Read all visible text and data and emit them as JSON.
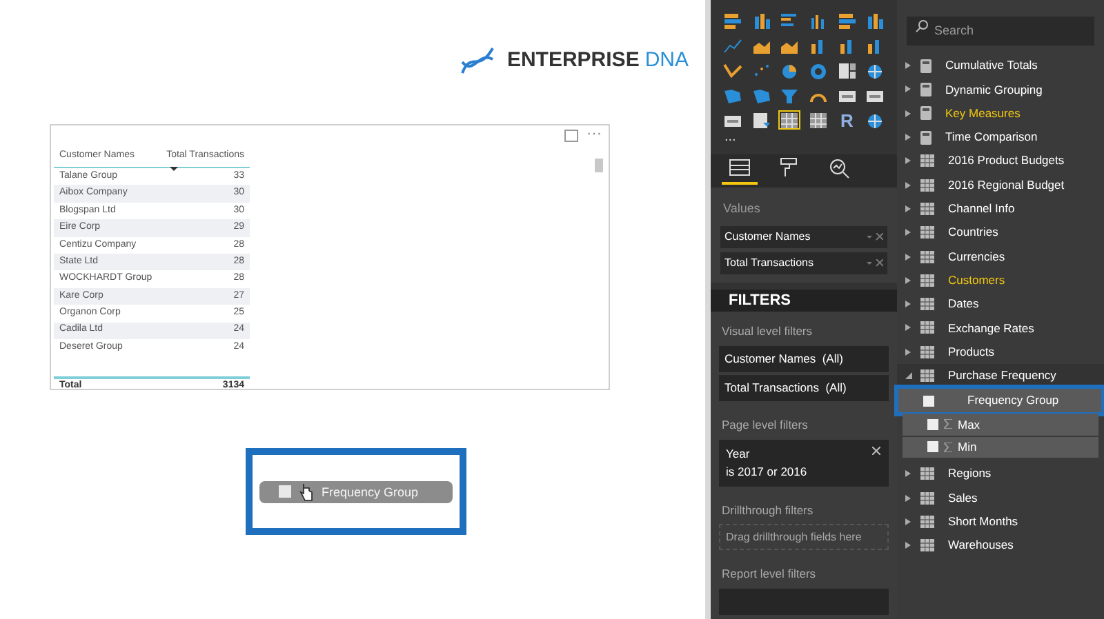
{
  "logo": {
    "text_bold": "ENTERPRISE",
    "text_light": "DNA"
  },
  "table_visual": {
    "menu": "···",
    "columns": [
      {
        "label": "Customer Names",
        "sorted": false
      },
      {
        "label": "Total Transactions",
        "sorted": true
      }
    ],
    "rows": [
      [
        "Talane Group",
        "33"
      ],
      [
        "Aibox Company",
        "30"
      ],
      [
        "Blogspan Ltd",
        "30"
      ],
      [
        "Eire Corp",
        "29"
      ],
      [
        "Centizu Company",
        "28"
      ],
      [
        "State Ltd",
        "28"
      ],
      [
        "WOCKHARDT Group",
        "28"
      ],
      [
        "Kare Corp",
        "27"
      ],
      [
        "Organon Corp",
        "25"
      ],
      [
        "Cadila Ltd",
        "24"
      ],
      [
        "Deseret Group",
        "24"
      ]
    ],
    "total": [
      "Total",
      "3134"
    ]
  },
  "drag_item": {
    "label": "Frequency Group",
    "checked": false,
    "outlined": true
  },
  "visualizations": {
    "gallery": [
      {
        "kind": "stacked-bar",
        "selected": false
      },
      {
        "kind": "stacked-column",
        "selected": false
      },
      {
        "kind": "clustered-bar",
        "selected": false
      },
      {
        "kind": "clustered-column",
        "selected": false
      },
      {
        "kind": "stacked-bar",
        "selected": false
      },
      {
        "kind": "stacked-column",
        "selected": false
      },
      {
        "kind": "line",
        "selected": false
      },
      {
        "kind": "area",
        "selected": false
      },
      {
        "kind": "area",
        "selected": false
      },
      {
        "kind": "column",
        "selected": false
      },
      {
        "kind": "column",
        "selected": false
      },
      {
        "kind": "column",
        "selected": false
      },
      {
        "kind": "ribbon",
        "selected": false
      },
      {
        "kind": "scatter",
        "selected": false
      },
      {
        "kind": "pie",
        "selected": false
      },
      {
        "kind": "donut",
        "selected": false
      },
      {
        "kind": "treemap",
        "selected": false
      },
      {
        "kind": "globe",
        "selected": false
      },
      {
        "kind": "map",
        "selected": false
      },
      {
        "kind": "map",
        "selected": false
      },
      {
        "kind": "funnel",
        "selected": false
      },
      {
        "kind": "gauge",
        "selected": false
      },
      {
        "kind": "card",
        "selected": false
      },
      {
        "kind": "card",
        "selected": false
      },
      {
        "kind": "card",
        "selected": false
      },
      {
        "kind": "slicer",
        "selected": false
      },
      {
        "kind": "table",
        "selected": true
      },
      {
        "kind": "table",
        "selected": false
      },
      {
        "kind": "glyph",
        "glyph": "R",
        "selected": false
      },
      {
        "kind": "globe",
        "selected": false
      }
    ],
    "more": "...",
    "tabs": [
      {
        "kind": "fields",
        "selected": true
      },
      {
        "kind": "format",
        "selected": false
      },
      {
        "kind": "analytics",
        "selected": false
      }
    ],
    "values_label": "Values",
    "values": [
      "Customer Names",
      "Total Transactions"
    ]
  },
  "filters": {
    "title": "FILTERS",
    "sections": [
      {
        "label": "Visual level filters",
        "items": [
          {
            "kind": "filter",
            "text": "Customer Names  (All)"
          },
          {
            "kind": "filter",
            "text": "Total Transactions  (All)"
          }
        ]
      },
      {
        "label": "Page level filters",
        "items": [
          {
            "kind": "condition",
            "field": "Year",
            "text": "is 2017 or 2016"
          }
        ]
      },
      {
        "label": "Drillthrough filters",
        "items": [
          {
            "kind": "dropzone",
            "text": "Drag drillthrough fields here"
          }
        ]
      },
      {
        "label": "Report level filters",
        "items": [
          {
            "kind": "filter"
          }
        ]
      }
    ]
  },
  "fields": {
    "search": {
      "placeholder": "Search"
    },
    "tables": [
      {
        "name": "Cumulative Totals",
        "kind": "measure",
        "in_use": false,
        "expanded": false
      },
      {
        "name": "Dynamic Grouping",
        "kind": "measure",
        "in_use": false,
        "expanded": false
      },
      {
        "name": "Key Measures",
        "kind": "measure",
        "in_use": true,
        "expanded": false
      },
      {
        "name": "Time Comparison",
        "kind": "measure",
        "in_use": false,
        "expanded": false
      },
      {
        "name": "2016 Product Budgets",
        "kind": "table",
        "in_use": false,
        "expanded": false
      },
      {
        "name": "2016 Regional Budget",
        "kind": "table",
        "in_use": false,
        "expanded": false
      },
      {
        "name": "Channel Info",
        "kind": "table",
        "in_use": false,
        "expanded": false
      },
      {
        "name": "Countries",
        "kind": "table",
        "in_use": false,
        "expanded": false
      },
      {
        "name": "Currencies",
        "kind": "table",
        "in_use": false,
        "expanded": false
      },
      {
        "name": "Customers",
        "kind": "table",
        "in_use": true,
        "expanded": false
      },
      {
        "name": "Dates",
        "kind": "table",
        "in_use": false,
        "expanded": false
      },
      {
        "name": "Exchange Rates",
        "kind": "table",
        "in_use": false,
        "expanded": false
      },
      {
        "name": "Products",
        "kind": "table",
        "in_use": false,
        "expanded": false
      },
      {
        "name": "Purchase Frequency",
        "kind": "table",
        "in_use": false,
        "expanded": true,
        "children": [
          {
            "name": "Frequency Group",
            "kind": "column",
            "checked": false,
            "outlined": true
          },
          {
            "name": "Max",
            "kind": "sum",
            "checked": false,
            "outlined": false
          },
          {
            "name": "Min",
            "kind": "sum",
            "checked": false,
            "outlined": false
          }
        ]
      },
      {
        "name": "Regions",
        "kind": "table",
        "in_use": false,
        "expanded": false
      },
      {
        "name": "Sales",
        "kind": "table",
        "in_use": false,
        "expanded": false
      },
      {
        "name": "Short Months",
        "kind": "table",
        "in_use": false,
        "expanded": false
      },
      {
        "name": "Warehouses",
        "kind": "table",
        "in_use": false,
        "expanded": false
      }
    ]
  }
}
